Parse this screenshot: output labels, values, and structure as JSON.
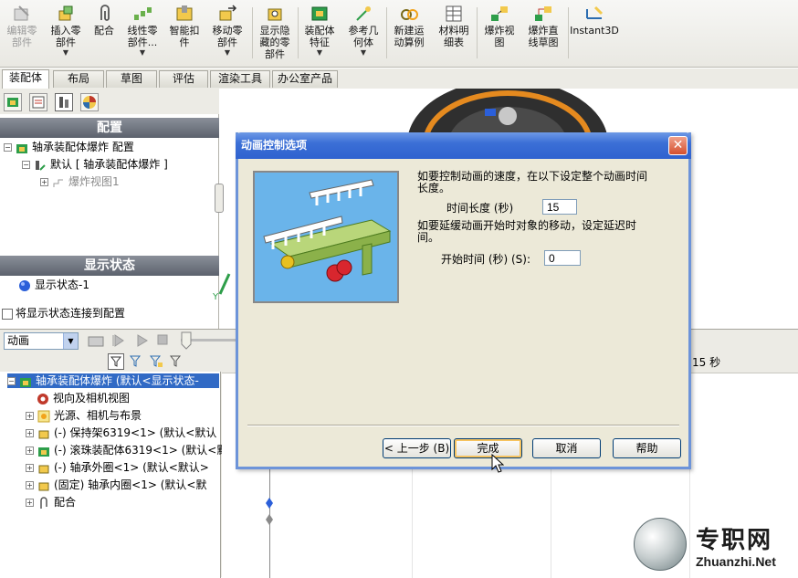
{
  "ribbon": {
    "buttons": [
      {
        "label": "编辑零\n部件",
        "disabled": true
      },
      {
        "label": "插入零\n部件",
        "disabled": false,
        "dropdown": true
      },
      {
        "label": "配合",
        "disabled": false
      },
      {
        "label": "线性零\n部件...",
        "disabled": false,
        "dropdown": true
      },
      {
        "label": "智能扣\n件",
        "disabled": false
      },
      {
        "label": "移动零\n部件",
        "disabled": false,
        "dropdown": true
      },
      {
        "label": "显示隐\n藏的零\n部件",
        "disabled": false
      },
      {
        "label": "装配体\n特征",
        "disabled": false,
        "dropdown": true
      },
      {
        "label": "参考几\n何体",
        "disabled": false,
        "dropdown": true
      },
      {
        "label": "新建运\n动算例",
        "disabled": false
      },
      {
        "label": "材料明\n细表",
        "disabled": false
      },
      {
        "label": "爆炸视\n图",
        "disabled": false
      },
      {
        "label": "爆炸直\n线草图",
        "disabled": false
      },
      {
        "label": "Instant3D",
        "disabled": false
      }
    ]
  },
  "tabs": [
    "装配体",
    "布局",
    "草图",
    "评估",
    "渲染工具",
    "办公室产品"
  ],
  "config_panel": {
    "header": "配置",
    "root": "轴承装配体爆炸  配置",
    "default_config": "默认 [ 轴承装配体爆炸 ]",
    "explode_view": "爆炸视图1"
  },
  "display_panel": {
    "header": "显示状态",
    "state": "显示状态-1",
    "link_checkbox": "将显示状态连接到配置"
  },
  "motion": {
    "study_type": "动画",
    "time_label": "15 秒",
    "tree": [
      {
        "label": "轴承装配体爆炸  (默认<显示状态-",
        "selected": true
      },
      {
        "label": "视向及相机视图",
        "selected": false
      },
      {
        "label": "光源、相机与布景",
        "selected": false
      },
      {
        "label": "(-) 保持架6319<1> (默认<默认",
        "selected": false
      },
      {
        "label": "(-) 滚珠装配体6319<1> (默认<默",
        "selected": false
      },
      {
        "label": "(-) 轴承外圈<1> (默认<默认>",
        "selected": false
      },
      {
        "label": "(固定) 轴承内圈<1> (默认<默",
        "selected": false
      },
      {
        "label": "配合",
        "selected": false
      }
    ]
  },
  "dialog": {
    "title": "动画控制选项",
    "close": "✕",
    "speed_text": "如要控制动画的速度，在以下设定整个动画时间长度。",
    "duration_label": "时间长度 (秒)",
    "duration_value": "15",
    "delay_text": "如要延缓动画开始时对象的移动，设定延迟时间。",
    "start_label": "开始时间 (秒) (S):",
    "start_value": "0",
    "buttons": {
      "back": "< 上一步 (B)",
      "finish": "完成",
      "cancel": "取消",
      "help": "帮助"
    }
  },
  "watermark": {
    "cn": "专职网",
    "en": "Zhuanzhi.Net"
  }
}
